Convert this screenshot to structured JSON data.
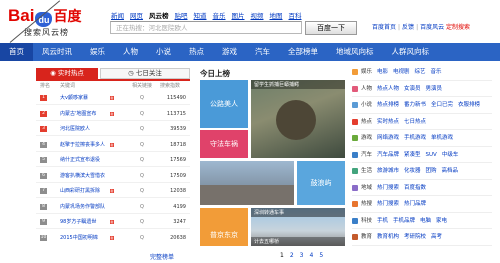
{
  "header": {
    "logo_text_bai": "Bai",
    "logo_paw": "du",
    "logo_text_du": "百度",
    "logo_subtitle": "搜索风云榜",
    "topnav": [
      "新闻",
      "网页",
      "风云榜",
      "贴吧",
      "知道",
      "音乐",
      "图片",
      "视频",
      "地图",
      "百科"
    ],
    "topnav_active": 2,
    "search_placeholder": "正在热搜：河北医院欧人",
    "search_button": "百度一下",
    "links": {
      "home": "百度首页",
      "feedback": "反馈",
      "about": "百度风云",
      "custom": "定制搜索"
    }
  },
  "nav": {
    "items": [
      "首页",
      "风云时讯",
      "娱乐",
      "人物",
      "小说",
      "热点",
      "游戏",
      "汽车",
      "全部榜单",
      "地域风向标",
      "人群风向标"
    ],
    "active": 0
  },
  "left_panel": {
    "tab_hot": "实时热点",
    "tab_week": "七日关注",
    "col_rank": "排名",
    "col_keyword": "关键词",
    "col_search": "相关链接",
    "col_count": "搜索指数",
    "rows": [
      {
        "rank": "1",
        "keyword": "大v颤哆家暴",
        "new": true,
        "count": "115490"
      },
      {
        "rank": "2",
        "keyword": "内蒙古'地图宣布",
        "new": true,
        "count": "113715"
      },
      {
        "rank": "3",
        "keyword": "河北医院欧人",
        "new": false,
        "count": "39539"
      },
      {
        "rank": "4",
        "keyword": "赵擎于拉擦丧事多人",
        "new": true,
        "count": "18718"
      },
      {
        "rank": "5",
        "keyword": "纳什正式宣布退役",
        "new": false,
        "count": "17569"
      },
      {
        "rank": "6",
        "keyword": "游客扒横滨大雪惜衣",
        "new": false,
        "count": "17509"
      },
      {
        "rank": "7",
        "keyword": "山西彩研打黑拆除",
        "new": true,
        "count": "12038"
      },
      {
        "rank": "8",
        "keyword": "内蒙巩场务作警部队",
        "new": false,
        "count": "4199"
      },
      {
        "rank": "9",
        "keyword": "98岁方子瞩遗世",
        "new": true,
        "count": "3247"
      },
      {
        "rank": "10",
        "keyword": "2015中国初明锦",
        "new": true,
        "count": "20638"
      }
    ],
    "search_icon_label": "Q",
    "more_link": "完整榜单"
  },
  "center": {
    "title": "今日上榜",
    "tiles": [
      {
        "label": "公路美人",
        "sub": ""
      },
      {
        "label": "留学生抓捕巨蟒捕鳄",
        "sub": ""
      },
      {
        "label": "守法车祸",
        "sub": ""
      },
      {
        "label": "鼓浪屿",
        "sub": ""
      },
      {
        "label": "深圳转通车事",
        "sub": "计去五哪桥"
      },
      {
        "label": "普京东京",
        "sub": ""
      }
    ],
    "pages": [
      "1",
      "2",
      "3",
      "4",
      "5"
    ],
    "current_page": 0
  },
  "right_panel": {
    "categories": [
      {
        "title": "娱乐",
        "items": [
          "电影",
          "电视剧",
          "综艺",
          "音乐"
        ],
        "color": "#f29c38"
      },
      {
        "title": "人物",
        "items": [
          "热点人物",
          "女演员",
          "男演员"
        ],
        "color": "#e25a7a"
      },
      {
        "title": "小说",
        "items": [
          "热点排榜",
          "番力新书",
          "全口已完",
          "衣服排榜"
        ],
        "color": "#5b9bd5"
      },
      {
        "title": "热点",
        "items": [
          "实时热点",
          "七日热点"
        ],
        "color": "#e43d2e"
      },
      {
        "title": "游戏",
        "items": [
          "网络游戏",
          "手机游戏",
          "单机游戏"
        ],
        "color": "#6aaa3a"
      },
      {
        "title": "汽车",
        "items": [
          "汽车品牌",
          "紧凑型",
          "SUV",
          "中级车"
        ],
        "color": "#3a7fc8"
      },
      {
        "title": "生活",
        "items": [
          "旅游城市",
          "化妆器",
          "团购",
          "高档品"
        ],
        "color": "#43a47d"
      },
      {
        "title": "地域",
        "items": [
          "热门搜索",
          "百度指数"
        ],
        "color": "#8a6cc8"
      },
      {
        "title": "热搜",
        "items": [
          "热门搜索",
          "热门品牌"
        ],
        "color": "#e8752e"
      },
      {
        "title": "科技",
        "items": [
          "手机",
          "手机品牌",
          "电脑",
          "家电"
        ],
        "color": "#3a7fc8"
      },
      {
        "title": "教育",
        "items": [
          "教育机构",
          "考研院校",
          "高考"
        ],
        "color": "#c45a2b"
      }
    ]
  },
  "colors": {
    "brand_red": "#e10601",
    "nav_blue": "#2b64c4",
    "hot_red": "#d8241c",
    "link_blue": "#0039c2"
  }
}
